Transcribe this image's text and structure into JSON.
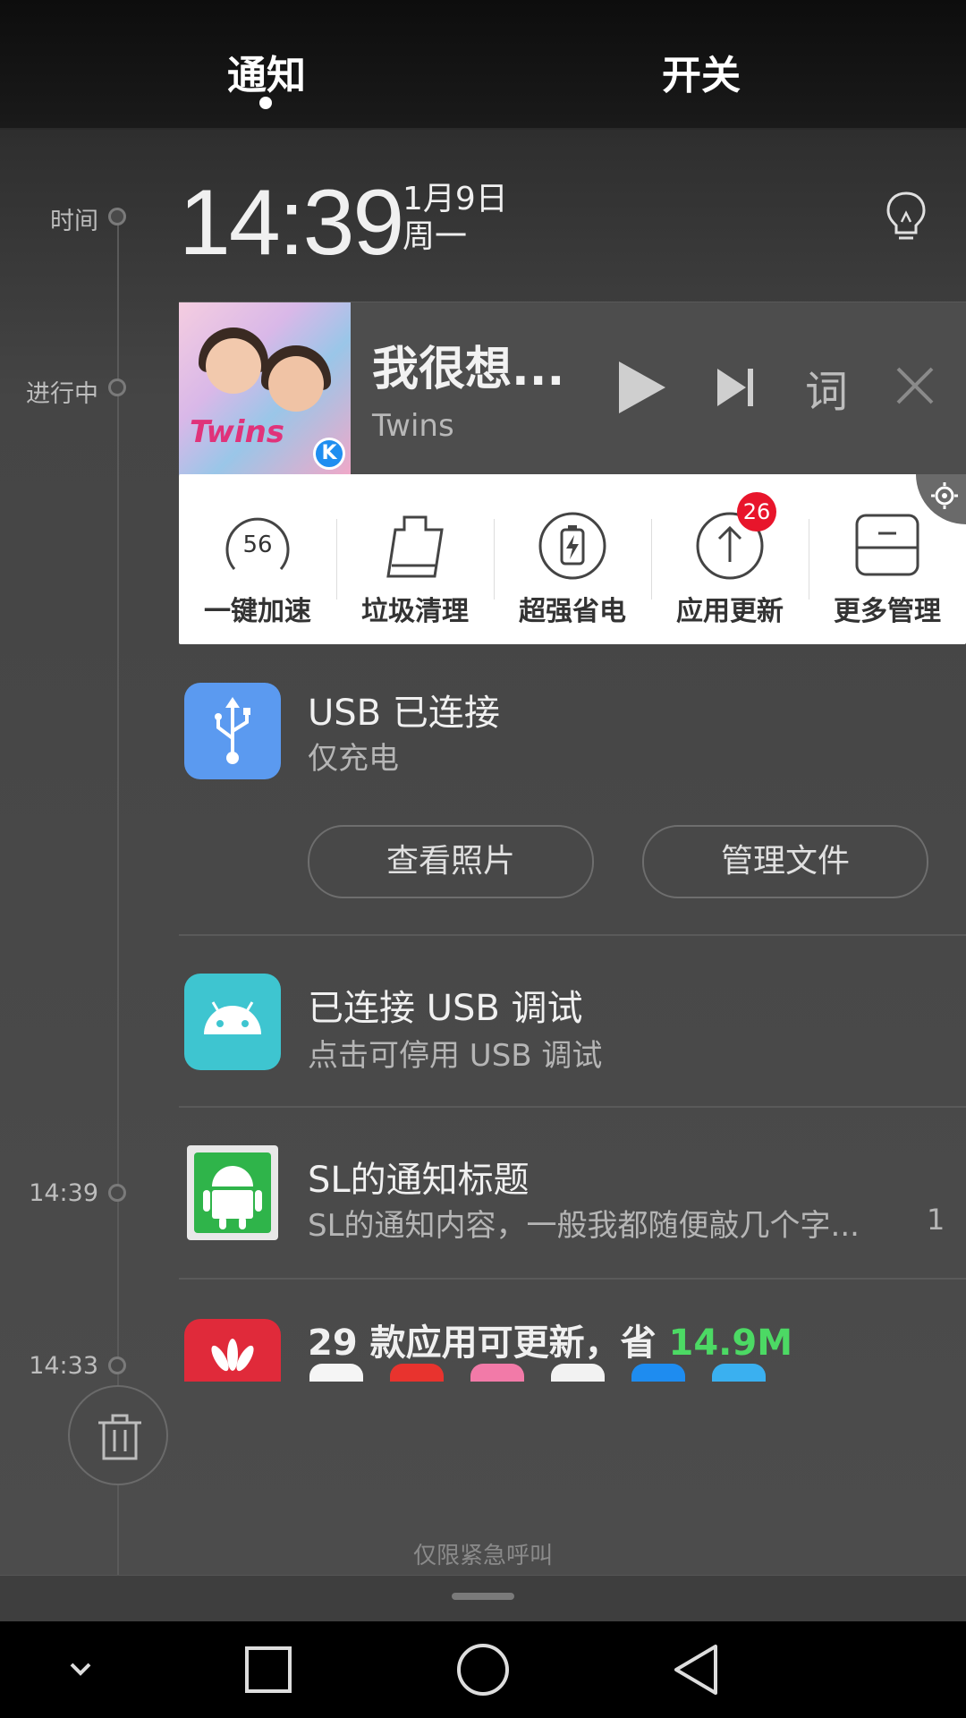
{
  "tabs": {
    "notify": "通知",
    "switches": "开关"
  },
  "timeline": {
    "time_label": "时间",
    "ongoing_label": "进行中",
    "t1": "14:39",
    "t2": "14:33"
  },
  "clock": {
    "time": "14:39",
    "date": "1月9日",
    "weekday": "周一"
  },
  "music": {
    "title": "我很想...",
    "artist": "Twins",
    "lyric_label": "词",
    "album_text": "Twins",
    "badge": "K"
  },
  "manager": {
    "items": [
      {
        "label": "一键加速",
        "value": "56"
      },
      {
        "label": "垃圾清理"
      },
      {
        "label": "超强省电"
      },
      {
        "label": "应用更新",
        "badge": "26"
      },
      {
        "label": "更多管理"
      }
    ]
  },
  "usb": {
    "title": "USB 已连接",
    "subtitle": "仅充电",
    "btn_photos": "查看照片",
    "btn_files": "管理文件"
  },
  "debug": {
    "title": "已连接 USB 调试",
    "subtitle": "点击可停用 USB 调试"
  },
  "sl": {
    "title": "SL的通知标题",
    "subtitle": "SL的通知内容，一般我都随便敲几个字...",
    "count": "1"
  },
  "update": {
    "title_pre": "29 款应用可更新，省 ",
    "title_size": "14.9M"
  },
  "emergency": "仅限紧急呼叫",
  "colors": {
    "usb_icon": "#5b9af0",
    "debug_icon": "#3ec5d0",
    "badge": "#e8152b",
    "update_size": "#4cd964"
  }
}
